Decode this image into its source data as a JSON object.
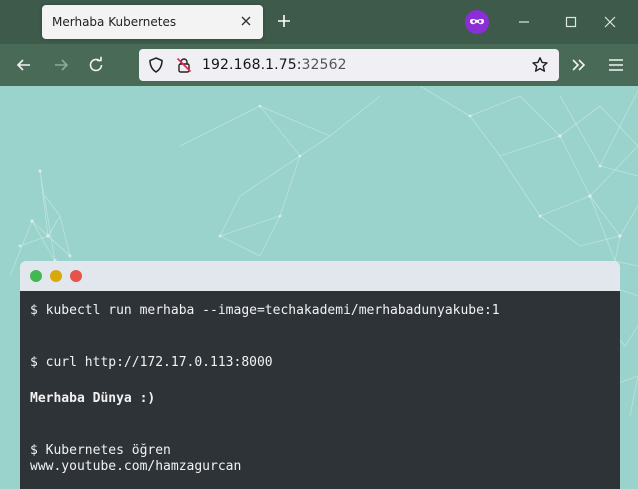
{
  "browser": {
    "tab_title": "Merhaba Kubernetes",
    "url_host": "192.168.1.75:",
    "url_port": "32562"
  },
  "colors": {
    "tabstrip": "#3e5a4a",
    "toolbar": "#4a6a58",
    "page_bg": "#9ad3cb",
    "terminal_bg": "#2e3338",
    "dot_green": "#3fb950",
    "dot_yellow": "#d9a80b",
    "dot_red": "#e5534b"
  },
  "icons": [
    "close-icon",
    "plus-icon",
    "private-browsing-icon",
    "minimize-icon",
    "maximize-icon",
    "back-icon",
    "forward-icon",
    "reload-icon",
    "shield-icon",
    "insecure-lock-icon",
    "bookmark-star-icon",
    "overflow-chevrons-icon",
    "menu-icon"
  ],
  "terminal": {
    "lines": [
      "$ kubectl run merhaba --image=techakademi/merhabadunyakube:1",
      "$ curl http://172.17.0.113:8000",
      "Merhaba Dünya :)",
      "$ Kubernetes öğren",
      "www.youtube.com/hamzagurcan"
    ]
  }
}
